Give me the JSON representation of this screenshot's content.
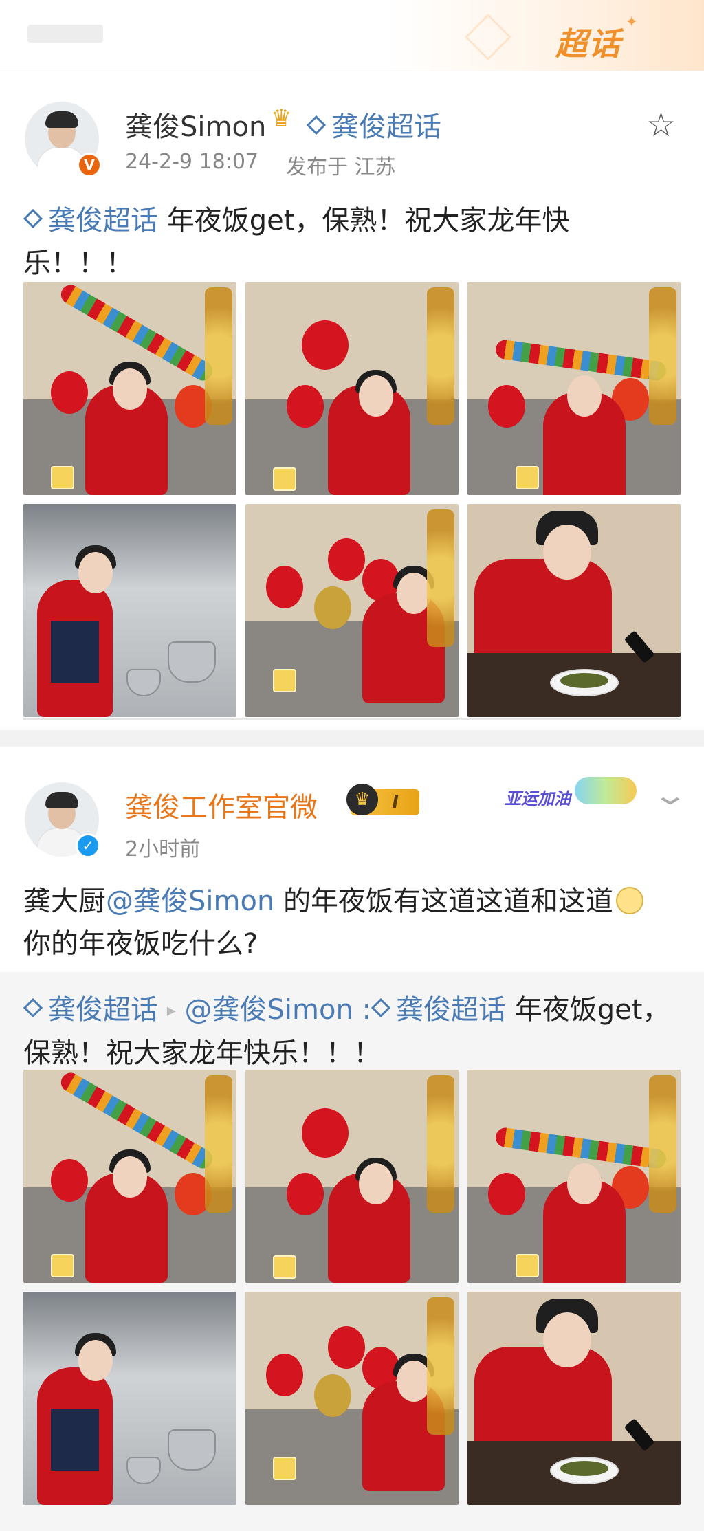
{
  "header": {
    "banner_label": "超话"
  },
  "post1": {
    "author": "龚俊Simon",
    "topic": "龚俊超话",
    "timestamp": "24-2-9 18:07",
    "location": "发布于 江苏",
    "text_topic": "龚俊超话",
    "text_line1": "年夜饭get，保熟！祝大家龙年快",
    "text_line2": "乐！！！",
    "verified_badge": "V",
    "star_icon": "star-icon"
  },
  "post2": {
    "author": "龚俊工作室官微",
    "vip_level": "I",
    "time_ago": "2小时前",
    "campaign_label": "亚运加油",
    "text_prefix": "龚大厨",
    "mention": "@龚俊Simon",
    "text_suffix": " 的年夜饭有这道这道和这道",
    "text_line2": "你的年夜饭吃什么?",
    "verified_badge": "✓",
    "repost": {
      "topic": "龚俊超话",
      "arrow": "▸",
      "author": "@龚俊Simon",
      "colon": " :",
      "topic2": "龚俊超话",
      "text_line1": " 年夜饭get，",
      "text_line2": "保熟！祝大家龙年快乐！！！"
    }
  },
  "colors": {
    "link_blue": "#4a7bb4",
    "brand_orange": "#e8761a",
    "festive_red": "#c8151d"
  }
}
